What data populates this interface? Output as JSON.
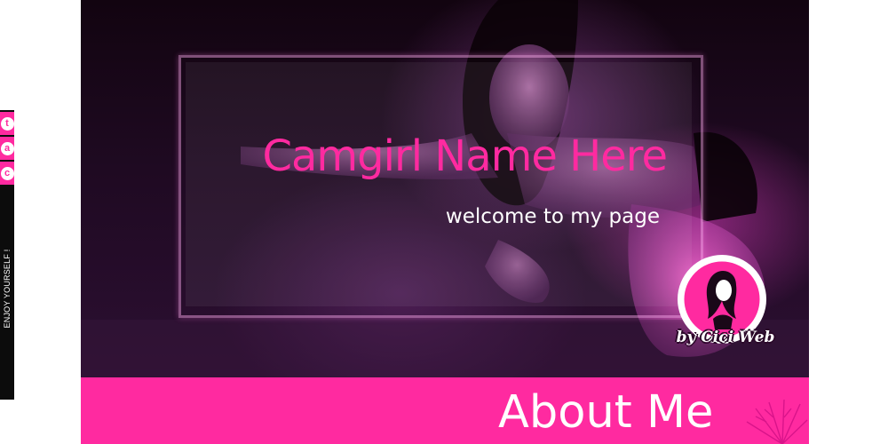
{
  "social": {
    "items": [
      {
        "name": "twitter",
        "glyph": "t"
      },
      {
        "name": "amazon",
        "glyph": "a"
      },
      {
        "name": "chaturbate",
        "glyph": "c"
      }
    ],
    "tagline": "ENJOY YOURSELF !"
  },
  "hero": {
    "title": "Camgirl Name Here",
    "subtitle": "welcome to my page"
  },
  "logo": {
    "text": "by Cici Web"
  },
  "about": {
    "title": "About Me"
  },
  "colors": {
    "accent": "#ff2aa0",
    "dark": "#120410",
    "white": "#ffffff"
  }
}
